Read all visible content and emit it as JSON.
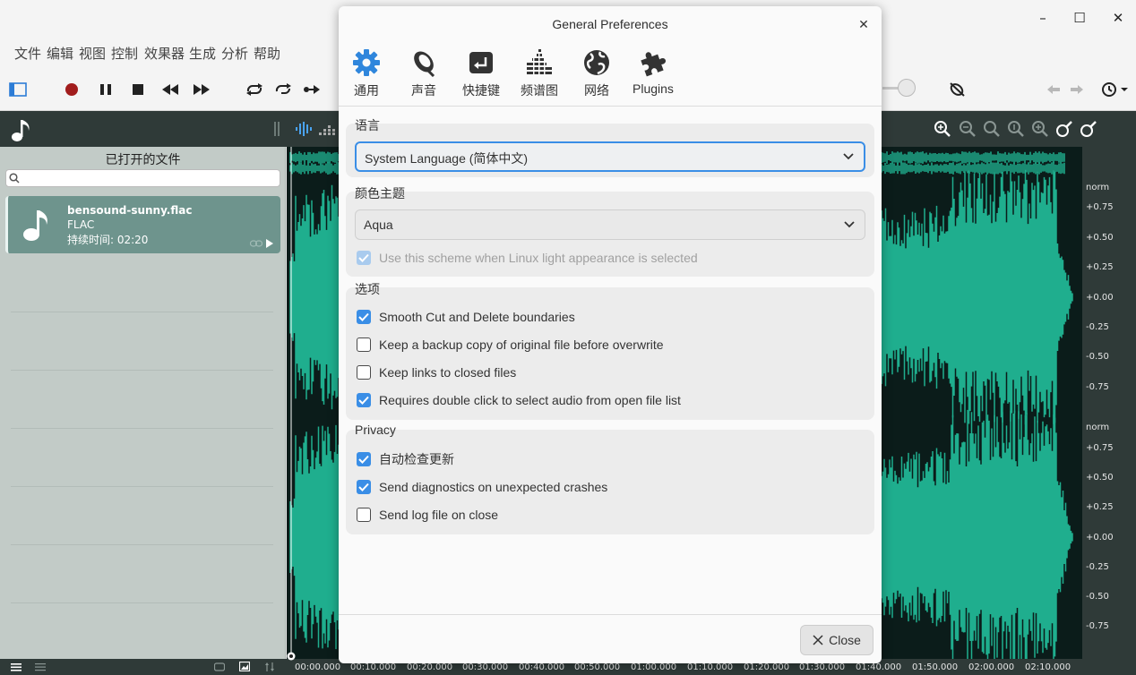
{
  "menu": [
    "文件",
    "编辑",
    "视图",
    "控制",
    "效果器",
    "生成",
    "分析",
    "帮助"
  ],
  "window_controls": {
    "minimize": "–",
    "maximize": "☐",
    "close": "✕"
  },
  "sidebar": {
    "title": "已打开的文件",
    "file": {
      "name": "bensound-sunny.flac",
      "format": "FLAC",
      "duration": "持续时间: 02:20"
    }
  },
  "timeline": [
    "00:00.000",
    "00:10.000",
    "00:20.000",
    "00:30.000",
    "00:40.000",
    "00:50.000",
    "01:00.000",
    "01:10.000",
    "01:20.000",
    "01:30.000",
    "01:40.000",
    "01:50.000",
    "02:00.000",
    "02:10.000"
  ],
  "scale": {
    "channel1": [
      "norm",
      "+0.75",
      "+0.50",
      "+0.25",
      "+0.00",
      "-0.25",
      "-0.50",
      "-0.75"
    ],
    "channel2": [
      "norm",
      "+0.75",
      "+0.50",
      "+0.25",
      "+0.00",
      "-0.25",
      "-0.50",
      "-0.75"
    ]
  },
  "dialog": {
    "title": "General Preferences",
    "tabs": [
      {
        "label": "通用",
        "icon": "gear-icon"
      },
      {
        "label": "声音",
        "icon": "speaker-icon"
      },
      {
        "label": "快捷键",
        "icon": "keyboard-icon"
      },
      {
        "label": "频谱图",
        "icon": "spectrogram-icon"
      },
      {
        "label": "网络",
        "icon": "network-icon"
      },
      {
        "label": "Plugins",
        "icon": "puzzle-icon"
      }
    ],
    "language": {
      "title": "语言",
      "value": "System Language (简体中文)"
    },
    "theme": {
      "title": "颜色主题",
      "value": "Aqua",
      "linux_option": "Use this scheme when Linux light appearance is selected"
    },
    "options": {
      "title": "选项",
      "items": [
        {
          "label": "Smooth Cut and Delete boundaries",
          "checked": true
        },
        {
          "label": "Keep a backup copy of original file before overwrite",
          "checked": false
        },
        {
          "label": "Keep links to closed files",
          "checked": false
        },
        {
          "label": "Requires double click to select audio from open file list",
          "checked": true
        }
      ]
    },
    "privacy": {
      "title": "Privacy",
      "items": [
        {
          "label": "自动检查更新",
          "checked": true
        },
        {
          "label": "Send diagnostics on unexpected crashes",
          "checked": true
        },
        {
          "label": "Send log file on close",
          "checked": false
        }
      ]
    },
    "close_label": "Close"
  },
  "colors": {
    "accent": "#3a8ee6",
    "waveform": "#1fae8e",
    "sidebar": "#c2cbc7",
    "file_card": "#6e948d"
  }
}
